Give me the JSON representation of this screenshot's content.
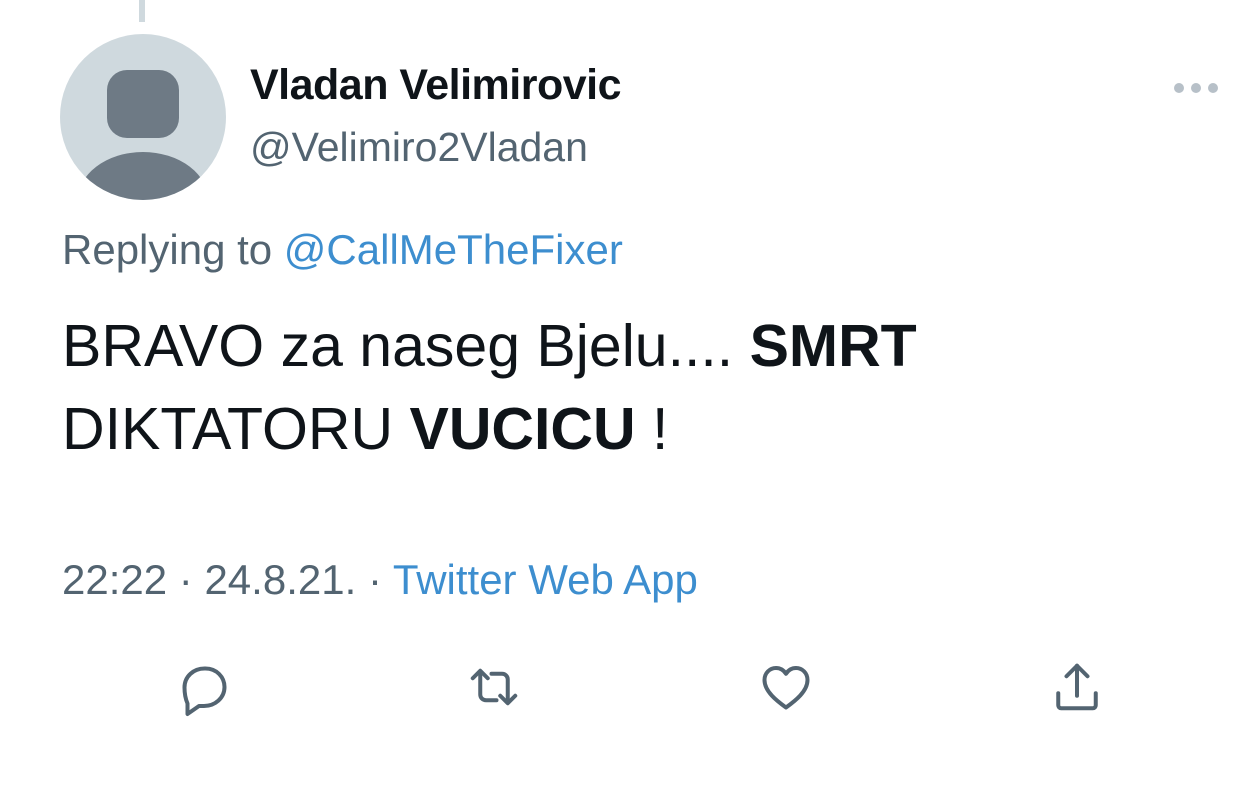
{
  "tweet": {
    "author": {
      "display_name": "Vladan Velimirovic",
      "handle": "@Velimiro2Vladan"
    },
    "replying_to": {
      "prefix": "Replying to",
      "mention": "@CallMeTheFixer"
    },
    "text": {
      "part1": "BRAVO za naseg Bjelu.... ",
      "part2_bold": "SMRT",
      "part3": "DIKTATORU ",
      "part4_bold": "VUCICU",
      "part5": " !"
    },
    "meta": {
      "time": "22:22",
      "separator": "·",
      "date": "24.8.21.",
      "source": "Twitter Web App"
    }
  },
  "icons": {
    "avatar": "default-avatar-icon",
    "more": "more-horizontal-icon",
    "reply": "reply-bubble-icon",
    "retweet": "retweet-icon",
    "like": "heart-icon",
    "share": "share-upload-icon"
  },
  "colors": {
    "text_primary": "#0f1419",
    "text_secondary": "#536471",
    "link": "#3d8ecf",
    "avatar_bg": "#cfd9de",
    "avatar_figure": "#6e7a85"
  }
}
